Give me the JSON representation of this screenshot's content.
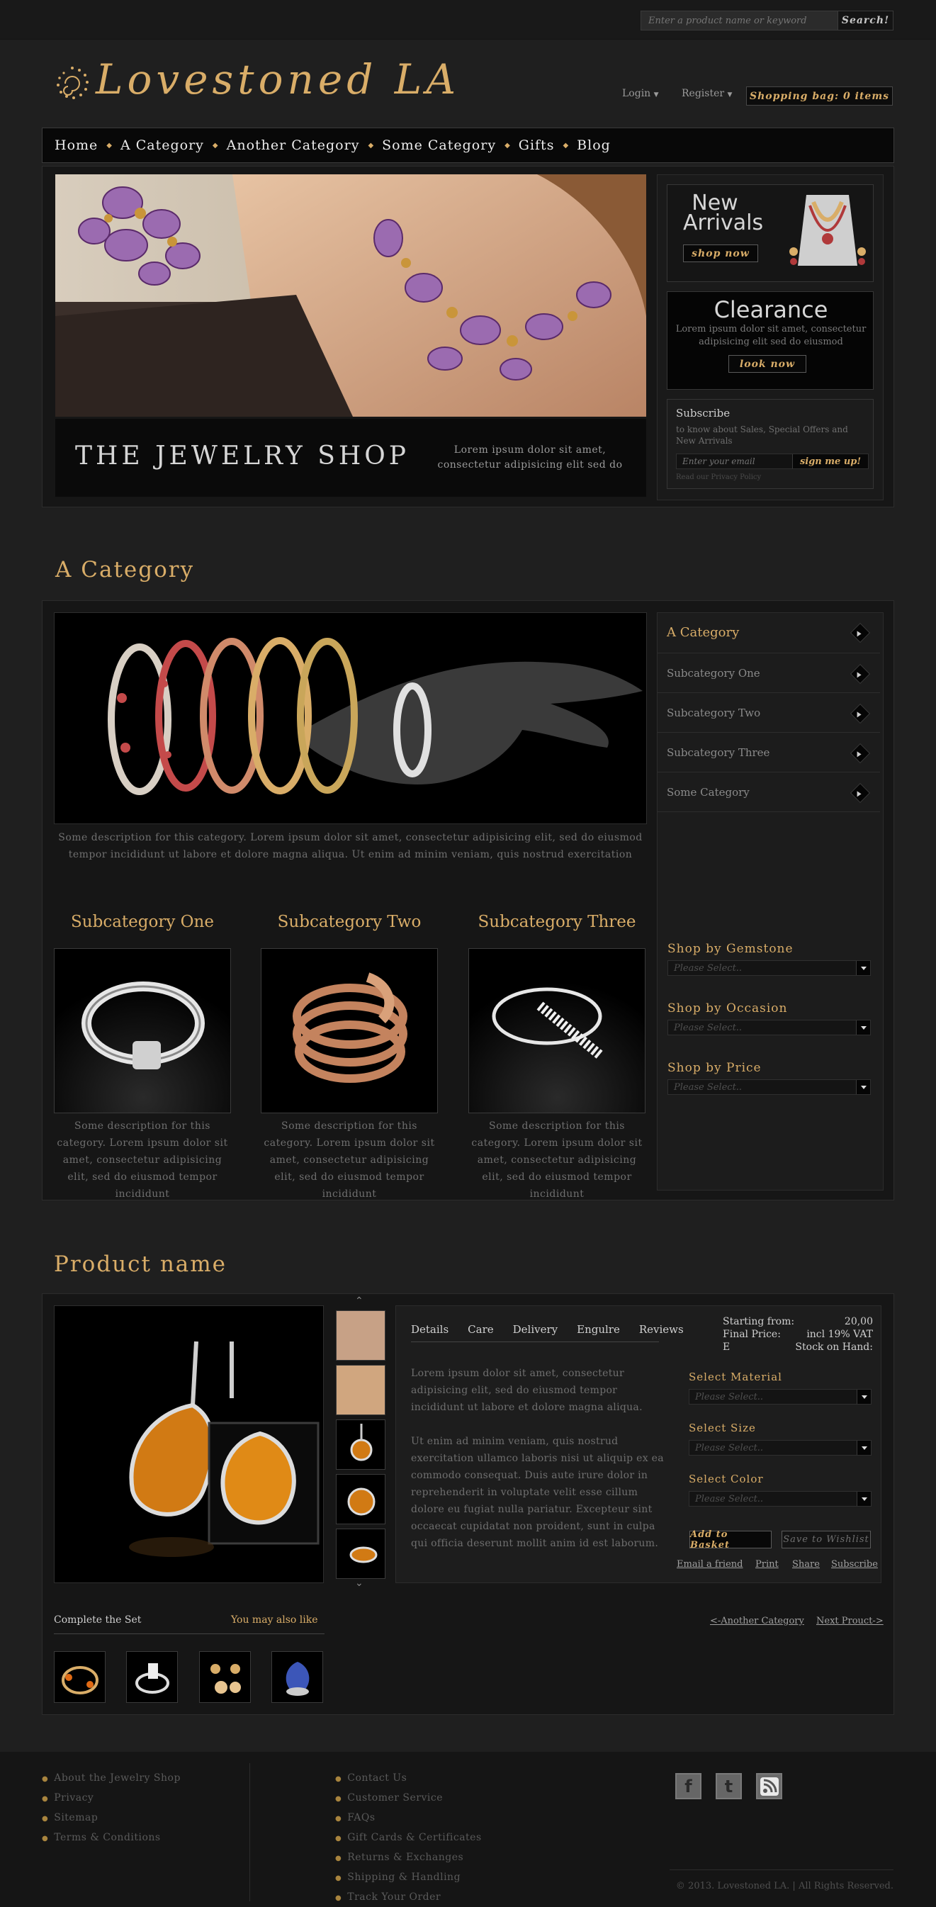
{
  "search": {
    "placeholder": "Enter a product name or keyword",
    "button": "Search!"
  },
  "brand": {
    "name": "Lovestoned LA"
  },
  "account": {
    "login": "Login",
    "register": "Register",
    "bag": "Shopping bag: 0 items"
  },
  "nav": {
    "items": [
      "Home",
      "A Category",
      "Another Category",
      "Some Category",
      "Gifts",
      "Blog"
    ]
  },
  "hero": {
    "title": "THE JEWELRY SHOP",
    "text": "Lorem ipsum dolor sit amet, consectetur adipisicing elit sed do"
  },
  "promo": {
    "new_title_1": "New",
    "new_title_2": "Arrivals",
    "new_button": "shop now",
    "clear_title": "Clearance",
    "clear_text": "Lorem ipsum dolor sit amet, consectetur adipisicing elit sed do eiusmod",
    "clear_button": "look now",
    "sub_title": "Subscribe",
    "sub_text": "to know about Sales, Special Offers and New Arrivals",
    "sub_placeholder": "Enter your email",
    "sub_button": "sign me up!",
    "sub_policy": "Read our Privacy Policy"
  },
  "category": {
    "title": "A Category",
    "description": "Some description for this category. Lorem ipsum dolor sit amet, consectetur adipisicing elit, sed do eiusmod tempor incididunt ut labore et dolore magna aliqua. Ut enim ad minim veniam, quis nostrud exercitation",
    "side_title": "A Category",
    "side_items": [
      "Subcategory One",
      "Subcategory Two",
      "Subcategory Three",
      "Some Category"
    ],
    "filters": [
      {
        "label": "Shop by Gemstone",
        "value": "Please Select.."
      },
      {
        "label": "Shop by Occasion",
        "value": "Please Select.."
      },
      {
        "label": "Shop by Price",
        "value": "Please Select.."
      }
    ],
    "subcats": [
      {
        "title": "Subcategory One",
        "desc": "Some description for this category. Lorem ipsum dolor sit amet, consectetur adipisicing elit, sed do eiusmod tempor incididunt"
      },
      {
        "title": "Subcategory Two",
        "desc": "Some description for this category. Lorem ipsum dolor sit amet, consectetur adipisicing elit, sed do eiusmod tempor incididunt"
      },
      {
        "title": "Subcategory Three",
        "desc": "Some description for this category. Lorem ipsum dolor sit amet, consectetur adipisicing elit, sed do eiusmod tempor incididunt"
      }
    ]
  },
  "product": {
    "title": "Product name",
    "tabs": [
      "Details",
      "Care",
      "Delivery",
      "Engulre",
      "Reviews"
    ],
    "para1": "Lorem ipsum dolor sit amet, consectetur adipisicing elit, sed do eiusmod tempor incididunt ut labore et dolore magna aliqua.",
    "para2": "Ut enim ad minim veniam, quis nostrud exercitation ullamco laboris nisi ut aliquip ex ea commodo consequat. Duis aute irure dolor in reprehenderit in voluptate velit esse cillum dolore eu fugiat nulla pariatur. Excepteur sint occaecat cupidatat non proident, sunt in culpa qui officia deserunt mollit anim id est laborum.",
    "price_label": "Starting from:",
    "price_value": "20,00",
    "final_label": "Final Price:",
    "final_value": "incl 19% VAT",
    "stock_prefix": "E",
    "stock_label": "Stock on Hand:",
    "options": [
      {
        "label": "Select Material",
        "value": "Please Select.."
      },
      {
        "label": "Select Size",
        "value": "Please Select.."
      },
      {
        "label": "Select Color",
        "value": "Please Select.."
      }
    ],
    "add_basket": "Add to Basket",
    "wishlist": "Save to Wishlist",
    "links": [
      "Email a friend",
      "Print",
      "Share",
      "Subscribe"
    ],
    "complete_set": "Complete the Set",
    "also_like": "You may also like",
    "prev": "<-Another Category",
    "next": "Next Prouct->"
  },
  "footer": {
    "col1": [
      "About the Jewelry Shop",
      "Privacy",
      "Sitemap",
      "Terms & Conditions"
    ],
    "col2": [
      "Contact Us",
      "Customer Service",
      "FAQs",
      "Gift Cards & Certificates",
      "Returns & Exchanges",
      "Shipping & Handling",
      "Track Your Order"
    ],
    "social": [
      "f",
      "t"
    ],
    "copyright": "© 2013. Lovestoned LA. | All Rights Reserved."
  }
}
